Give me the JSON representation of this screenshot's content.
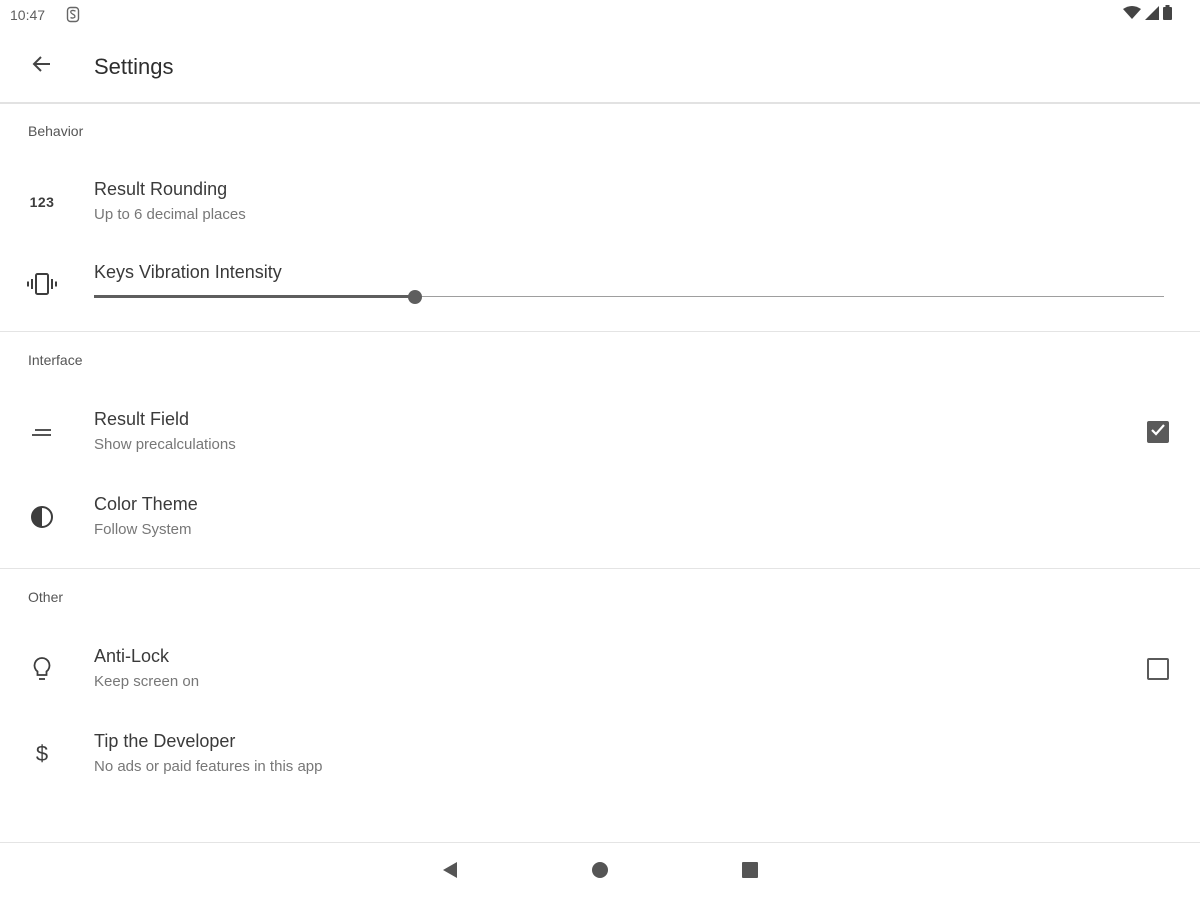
{
  "status_bar": {
    "time": "10:47",
    "icons": [
      "notification-s-icon",
      "wifi-icon",
      "signal-icon",
      "battery-icon"
    ]
  },
  "app_bar": {
    "title": "Settings",
    "back_icon": "arrow-back-icon"
  },
  "sections": [
    {
      "header": "Behavior",
      "items": [
        {
          "title": "Result Rounding",
          "summary": "Up to 6 decimal places",
          "icon": "123",
          "icon_name": "numbers-icon"
        },
        {
          "title": "Keys Vibration Intensity",
          "icon_name": "vibration-icon",
          "slider_value": 0.3
        }
      ]
    },
    {
      "header": "Interface",
      "items": [
        {
          "title": "Result Field",
          "summary": "Show precalculations",
          "icon_name": "equals-icon",
          "checked": true
        },
        {
          "title": "Color Theme",
          "summary": "Follow System",
          "icon_name": "contrast-icon"
        }
      ]
    },
    {
      "header": "Other",
      "items": [
        {
          "title": "Anti-Lock",
          "summary": "Keep screen on",
          "icon_name": "lightbulb-icon",
          "checked": false
        },
        {
          "title": "Tip the Developer",
          "summary": "No ads or paid features in this app",
          "icon": "$",
          "icon_name": "dollar-icon"
        }
      ]
    }
  ],
  "nav_bar": {
    "icons": [
      "nav-back-icon",
      "nav-home-icon",
      "nav-recents-icon"
    ]
  },
  "colors": {
    "background": "#ffffff",
    "icon": "#3d3d3d",
    "control": "#5a5a5a",
    "divider": "#e4e4e4"
  }
}
